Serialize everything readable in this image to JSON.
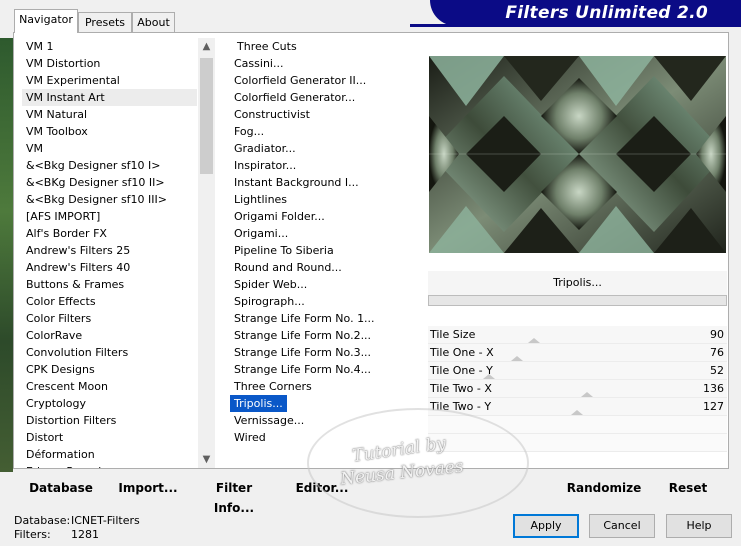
{
  "tabs": [
    {
      "label": "Navigator"
    },
    {
      "label": "Presets"
    },
    {
      "label": "About"
    }
  ],
  "banner": "Filters Unlimited 2.0",
  "categories": [
    "VM 1",
    "VM Distortion",
    "VM Experimental",
    "VM Instant Art",
    "VM Natural",
    "VM Toolbox",
    "VM",
    "&<Bkg Designer sf10 I>",
    "&<BKg Designer sf10 II>",
    "&<Bkg Designer sf10 III>",
    "[AFS IMPORT]",
    "Alf's Border FX",
    "Andrew's Filters 25",
    "Andrew's Filters 40",
    "Buttons & Frames",
    "Color Effects",
    "Color Filters",
    "ColorRave",
    "Convolution Filters",
    "CPK Designs",
    "Crescent Moon",
    "Cryptology",
    "Distortion Filters",
    "Distort",
    "Déformation",
    "Edges, Round"
  ],
  "selected_category": "VM Instant Art",
  "filters": [
    "Three Cuts",
    "Cassini...",
    "Colorfield Generator II...",
    "Colorfield Generator...",
    "Constructivist",
    "Fog...",
    "Gradiator...",
    "Inspirator...",
    "Instant Background I...",
    "Lightlines",
    "Origami Folder...",
    "Origami...",
    "Pipeline To Siberia",
    "Round and Round...",
    "Spider Web...",
    "Spirograph...",
    "Strange Life Form No. 1...",
    "Strange Life Form No.2...",
    "Strange Life Form No.3...",
    "Strange Life Form No.4...",
    "Three Corners",
    "Tripolis...",
    "Vernissage...",
    "Wired"
  ],
  "selected_filter": "Tripolis...",
  "filter_name": "Tripolis...",
  "params": [
    {
      "label": "Tile Size",
      "value": "90",
      "fraction": 0.353
    },
    {
      "label": "Tile One - X",
      "value": "76",
      "fraction": 0.298
    },
    {
      "label": "Tile One - Y",
      "value": "52",
      "fraction": 0.204
    },
    {
      "label": "Tile Two - X",
      "value": "136",
      "fraction": 0.533
    },
    {
      "label": "Tile Two - Y",
      "value": "127",
      "fraction": 0.498
    }
  ],
  "toolbar": {
    "database": "Database",
    "import": "Import...",
    "filter_info": "Filter Info...",
    "editor": "Editor...",
    "randomize": "Randomize",
    "reset": "Reset"
  },
  "buttons": {
    "apply": "Apply",
    "cancel": "Cancel",
    "help": "Help"
  },
  "footer": {
    "database_label": "Database:",
    "database_value": "ICNET-Filters",
    "filters_label": "Filters:",
    "filters_value": "1281"
  },
  "watermark": {
    "line1": "Tutorial by",
    "line2": "Neusa Novaes"
  },
  "colors": {
    "banner": "#0b0b86",
    "selection": "#0a58c8",
    "accent": "#0078d7"
  }
}
